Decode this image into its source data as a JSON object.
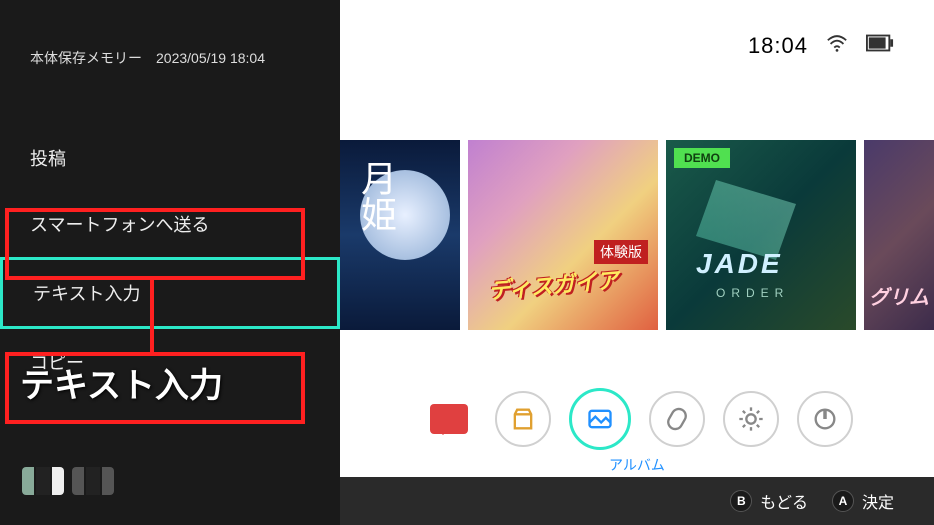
{
  "panel": {
    "header": "本体保存メモリー　2023/05/19 18:04",
    "menu": {
      "post": "投稿",
      "send_smartphone": "スマートフォンへ送る",
      "text_input": "テキスト入力",
      "copy": "コピー"
    },
    "callout_label": "テキスト入力"
  },
  "status": {
    "time": "18:04"
  },
  "games": [
    {
      "title": "月姫",
      "kanji": "月姫"
    },
    {
      "title": "ディスガイア",
      "logo": "ディスガイア",
      "sub": "体験版"
    },
    {
      "title": "Jade Order",
      "logo": "JADE",
      "sub": "ORDER",
      "badge": "DEMO"
    },
    {
      "title": "グリム",
      "logo": "グリム"
    }
  ],
  "nav": {
    "selected_label": "アルバム"
  },
  "footer": {
    "back": "もどる",
    "back_btn": "B",
    "ok": "決定",
    "ok_btn": "A"
  }
}
